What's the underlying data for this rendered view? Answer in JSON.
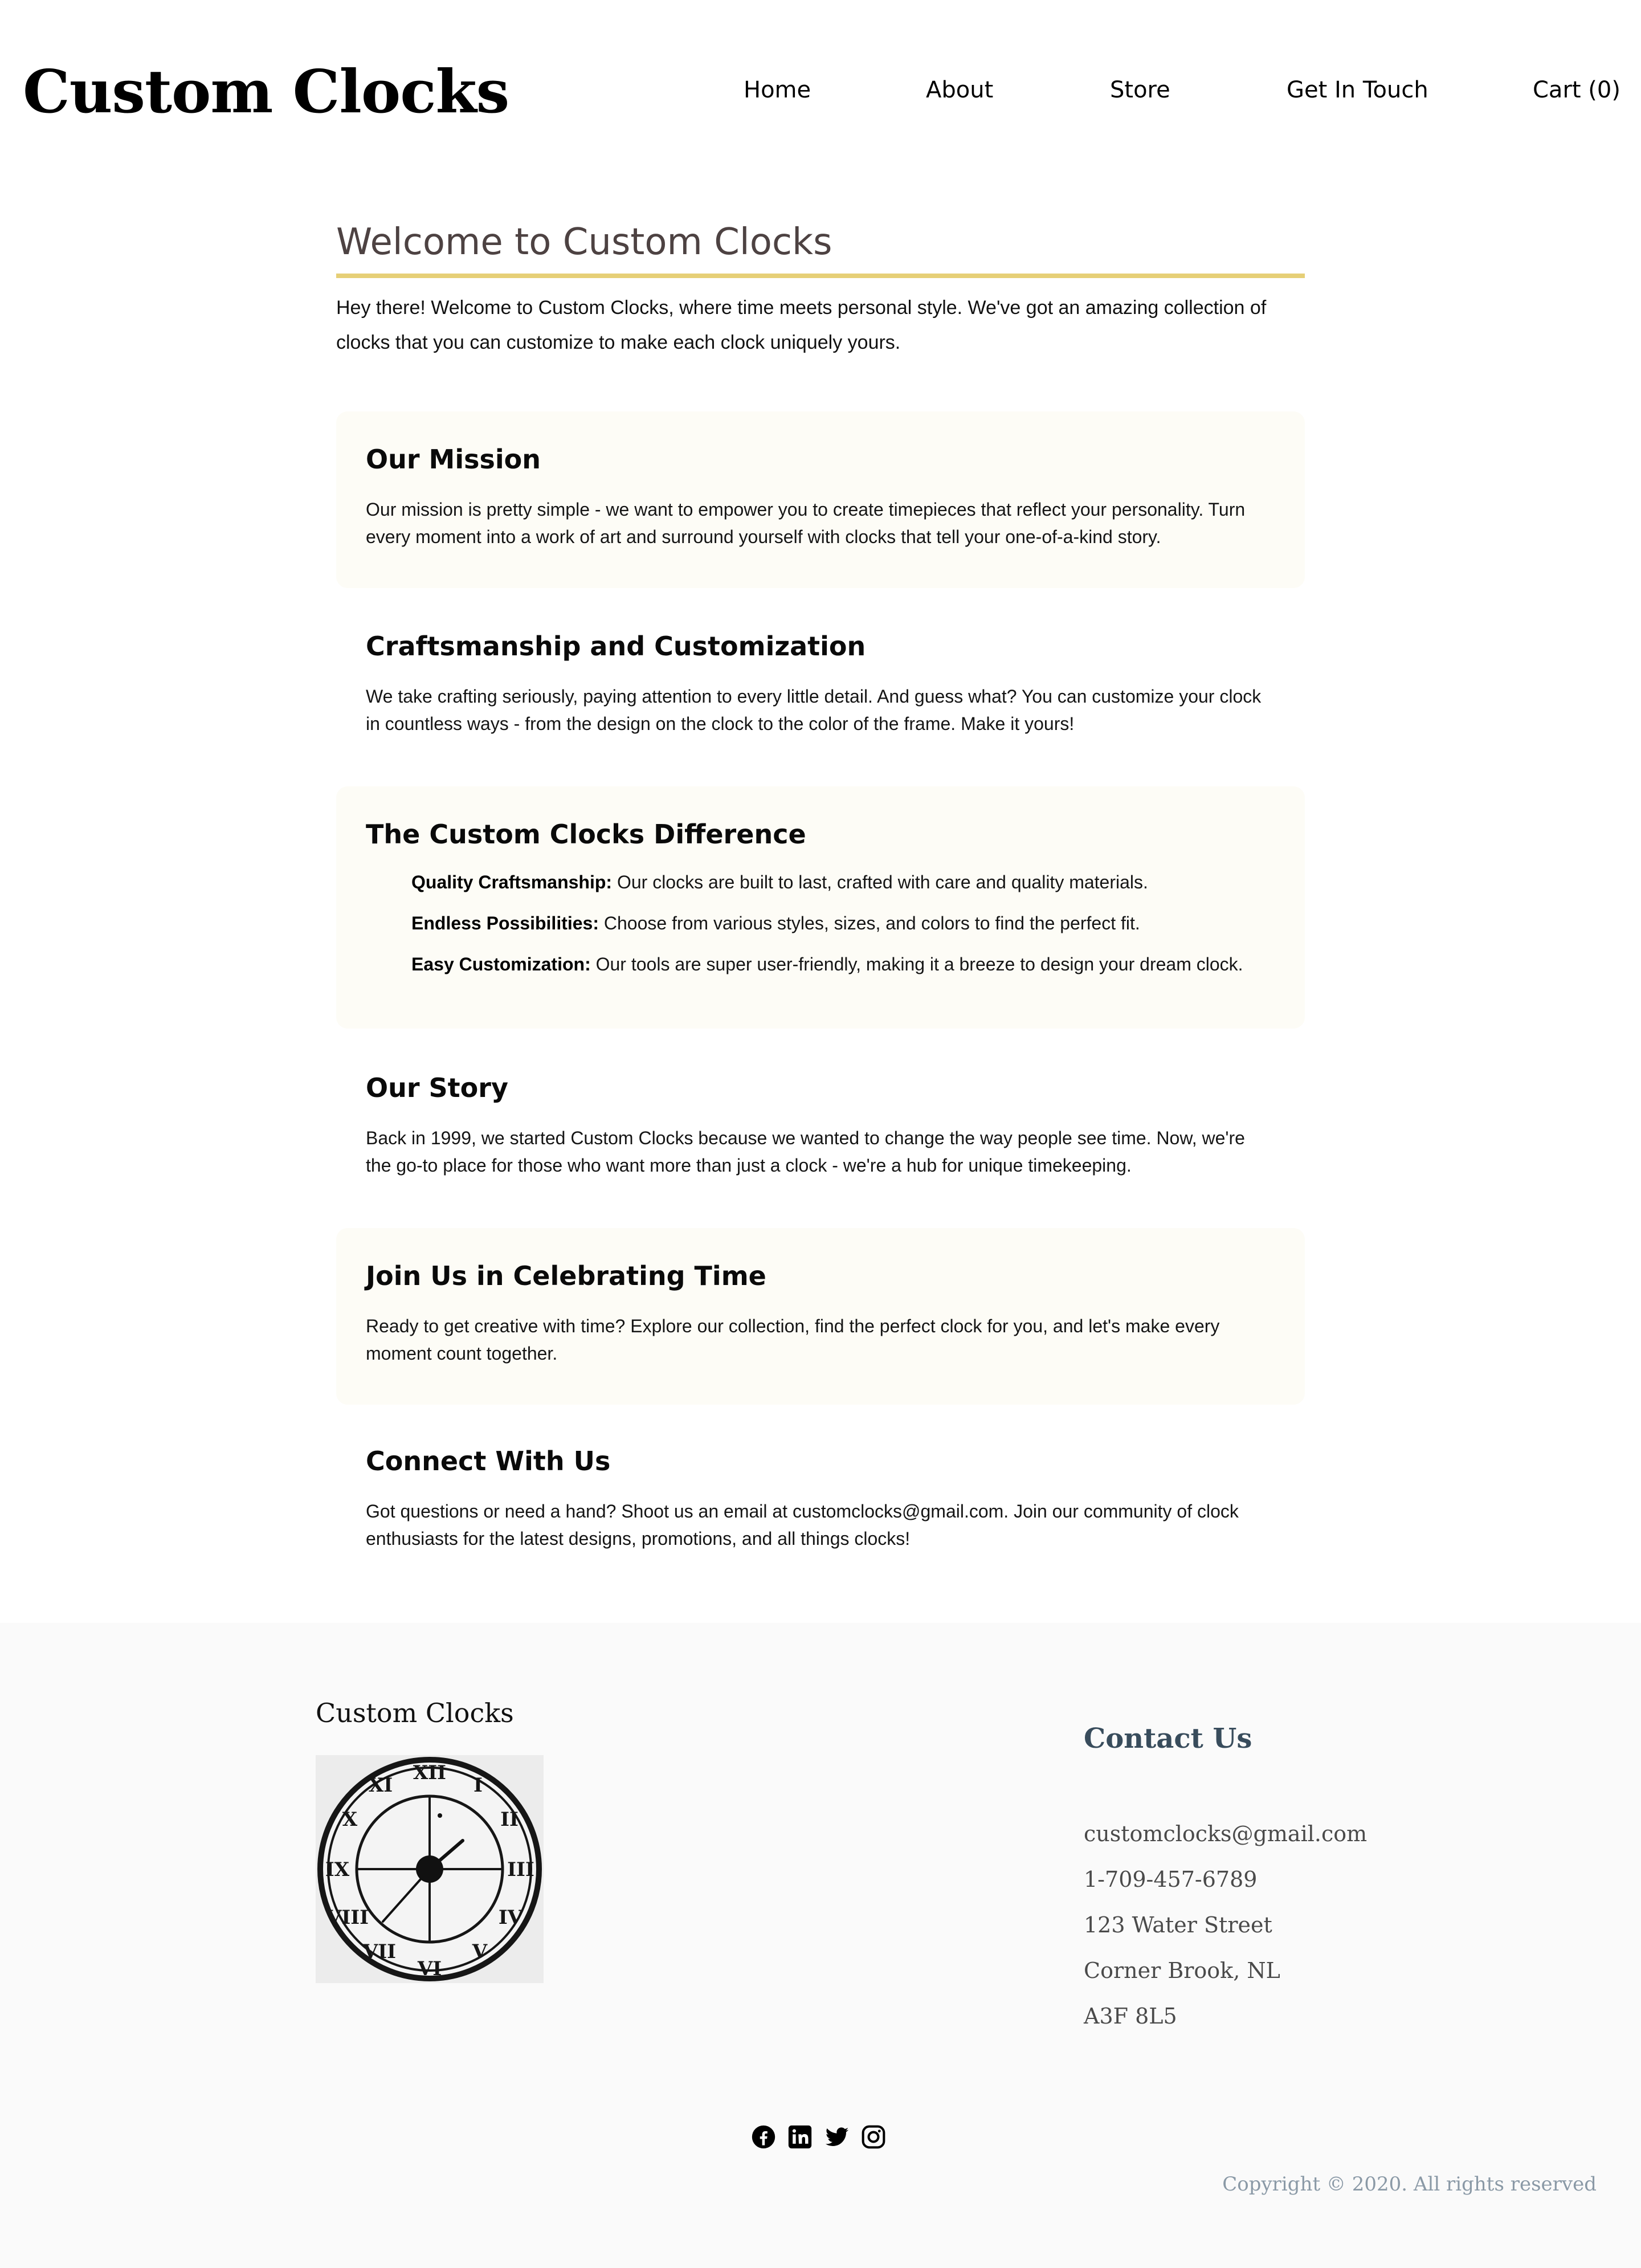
{
  "header": {
    "logo": "Custom Clocks",
    "nav": {
      "home": "Home",
      "about": "About",
      "store": "Store",
      "get_in_touch": "Get In Touch",
      "cart": "Cart (0)"
    }
  },
  "main": {
    "title": "Welcome to Custom Clocks",
    "intro": "Hey there! Welcome to Custom Clocks, where time meets personal style. We've got an amazing collection of clocks that you can customize to make each clock uniquely yours.",
    "sections": {
      "mission": {
        "title": "Our Mission",
        "body": "Our mission is pretty simple - we want to empower you to create timepieces that reflect your personality. Turn every moment into a work of art and surround yourself with clocks that tell your one-of-a-kind story."
      },
      "craft": {
        "title": "Craftsmanship and Customization",
        "body": "We take crafting seriously, paying attention to every little detail. And guess what? You can customize your clock in countless ways - from the design on the clock to the color of the frame. Make it yours!"
      },
      "difference": {
        "title": "The Custom Clocks Difference",
        "items": [
          {
            "label": "Quality Craftsmanship:",
            "text": " Our clocks are built to last, crafted with care and quality materials."
          },
          {
            "label": "Endless Possibilities:",
            "text": " Choose from various styles, sizes, and colors to find the perfect fit."
          },
          {
            "label": "Easy Customization:",
            "text": " Our tools are super user-friendly, making it a breeze to design your dream clock."
          }
        ]
      },
      "story": {
        "title": "Our Story",
        "body": "Back in 1999, we started Custom Clocks because we wanted to change the way people see time. Now, we're the go-to place for those who want more than just a clock - we're a hub for unique timekeeping."
      },
      "join": {
        "title": "Join Us in Celebrating Time",
        "body": "Ready to get creative with time? Explore our collection, find the perfect clock for you, and let's make every moment count together."
      },
      "connect": {
        "title": "Connect With Us",
        "body": "Got questions or need a hand? Shoot us an email at customclocks@gmail.com. Join our community of clock enthusiasts for the latest designs, promotions, and all things clocks!"
      }
    }
  },
  "footer": {
    "brand": "Custom Clocks",
    "image_icon": "wall-clock-roman-numerals",
    "contact_title": "Contact Us",
    "contact": {
      "email": "customclocks@gmail.com",
      "phone": "1-709-457-6789",
      "street": "123 Water Street",
      "city": "Corner Brook, NL",
      "postal": "A3F 8L5"
    },
    "social_icons": [
      "facebook-icon",
      "linkedin-icon",
      "twitter-icon",
      "instagram-icon"
    ],
    "copyright": "Copyright © 2020. All rights reserved"
  },
  "colors": {
    "title": "#4d4242",
    "accent_rule": "#e6cf77",
    "card_tint": "#fdfcf6",
    "footer_bg": "#fafafa",
    "contact_title": "#384c5c",
    "copyright": "#8a99a6"
  }
}
